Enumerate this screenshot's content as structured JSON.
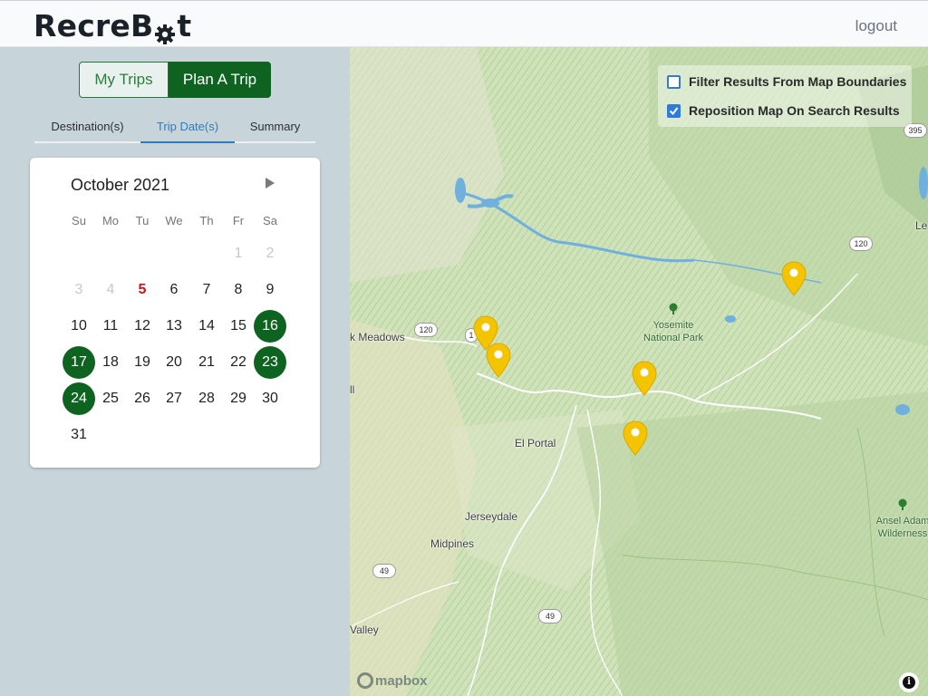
{
  "app": {
    "logo_prefix": "RecreB",
    "logo_suffix": "t",
    "logout_label": "logout"
  },
  "toggle": {
    "my_trips": "My Trips",
    "plan_trip": "Plan A Trip",
    "active": "Plan A Trip"
  },
  "tabs": [
    {
      "label": "Destination(s)",
      "active": false
    },
    {
      "label": "Trip Date(s)",
      "active": true
    },
    {
      "label": "Summary",
      "active": false
    }
  ],
  "calendar": {
    "month_label": "October 2021",
    "weekdays": [
      "Su",
      "Mo",
      "Tu",
      "We",
      "Th",
      "Fr",
      "Sa"
    ],
    "weeks": [
      [
        null,
        null,
        null,
        null,
        null,
        {
          "d": "1",
          "s": "dim"
        },
        {
          "d": "2",
          "s": "dim"
        }
      ],
      [
        {
          "d": "3",
          "s": "dim"
        },
        {
          "d": "4",
          "s": "dim"
        },
        {
          "d": "5",
          "s": "today"
        },
        {
          "d": "6"
        },
        {
          "d": "7"
        },
        {
          "d": "8"
        },
        {
          "d": "9"
        }
      ],
      [
        {
          "d": "10"
        },
        {
          "d": "11"
        },
        {
          "d": "12"
        },
        {
          "d": "13"
        },
        {
          "d": "14"
        },
        {
          "d": "15"
        },
        {
          "d": "16",
          "s": "sel"
        }
      ],
      [
        {
          "d": "17",
          "s": "sel"
        },
        {
          "d": "18"
        },
        {
          "d": "19"
        },
        {
          "d": "20"
        },
        {
          "d": "21"
        },
        {
          "d": "22"
        },
        {
          "d": "23",
          "s": "sel"
        }
      ],
      [
        {
          "d": "24",
          "s": "sel"
        },
        {
          "d": "25"
        },
        {
          "d": "26"
        },
        {
          "d": "27"
        },
        {
          "d": "28"
        },
        {
          "d": "29"
        },
        {
          "d": "30"
        }
      ],
      [
        {
          "d": "31"
        },
        null,
        null,
        null,
        null,
        null,
        null
      ]
    ]
  },
  "map": {
    "filters": [
      {
        "label": "Filter Results From Map Boundaries",
        "checked": false
      },
      {
        "label": "Reposition Map On Search Results",
        "checked": true
      }
    ],
    "labels": [
      "k Meadows",
      "El Portal",
      "Jerseydale",
      "Midpines",
      "Valley",
      "ll",
      "Le"
    ],
    "parks": [
      "Yosemite\nNational Park",
      "Ansel Adam\nWilderness"
    ],
    "route_shields": [
      "120",
      "1",
      "120",
      "395",
      "49",
      "49"
    ],
    "attribution": "mapbox",
    "pin_count": 5,
    "colors": {
      "pin": "#f5c400",
      "selected": "#0e6321",
      "today": "#c4171f",
      "accent": "#2f7bbd"
    }
  }
}
